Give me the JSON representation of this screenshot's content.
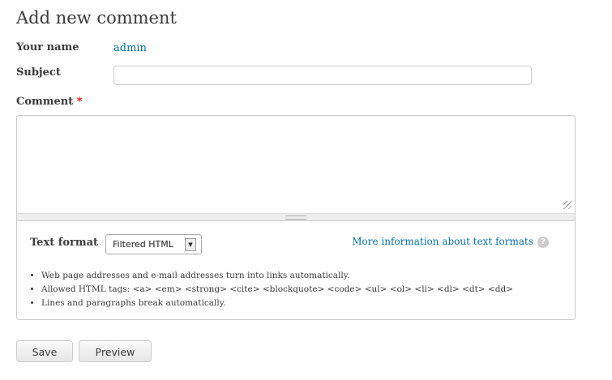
{
  "form": {
    "title": "Add new comment",
    "your_name_label": "Your name",
    "your_name_value": "admin",
    "subject_label": "Subject",
    "subject_value": "",
    "comment_label": "Comment",
    "required_marker": "*",
    "comment_value": "",
    "text_format_label": "Text format",
    "text_format_selected": "Filtered HTML",
    "more_info_link": "More information about text formats",
    "help_icon": "?",
    "tips": [
      "Web page addresses and e-mail addresses turn into links automatically.",
      "Allowed HTML tags: <a> <em> <strong> <cite> <blockquote> <code> <ul> <ol> <li> <dl> <dt> <dd>",
      "Lines and paragraphs break automatically."
    ],
    "save_label": "Save",
    "preview_label": "Preview"
  }
}
